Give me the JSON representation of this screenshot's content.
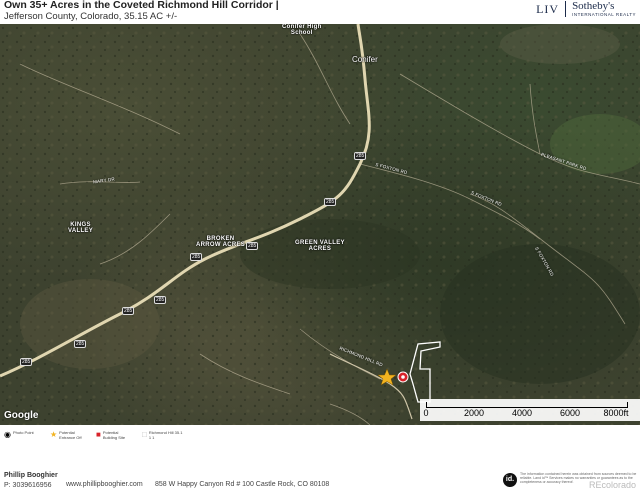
{
  "header": {
    "title": "Own 35+ Acres in the Coveted Richmond Hill Corridor |",
    "subtitle": "Jefferson County, Colorado, 35.15 AC +/-",
    "brand_liv": "LIV",
    "brand_name": "Sotheby's",
    "brand_tagline": "INTERNATIONAL REALTY"
  },
  "map": {
    "places": {
      "conifer_hs": "Conifer High School",
      "conifer": "Conifer",
      "kings_valley": "KINGS VALLEY",
      "broken_arrow": "BROKEN ARROW ACRES",
      "green_valley": "GREEN VALLEY ACRES"
    },
    "roads": {
      "mary_dr": "MARY DR",
      "s_foxton_1": "S FOXTON RD",
      "s_foxton_2": "S FOXTON RD",
      "s_foxton_3": "S FOXTON RD",
      "pleasant_park": "PLEASANT PARK RD",
      "richmond_hill": "RICHMOND HILL RD"
    },
    "route_shield": "285",
    "watermark": "Google",
    "scale": {
      "labels": [
        "0",
        "2000",
        "4000",
        "6000",
        "8000ft"
      ]
    }
  },
  "legend": {
    "photo_point": "Photo Point",
    "entrance": "Potential Entrance Off",
    "building_site": "Potential Building Site",
    "parcel": "Richmond Hill 35.1 1 1"
  },
  "footer": {
    "name": "Phillip Booghier",
    "phone": "P: 3039616956",
    "website": "www.phillipbooghier.com",
    "address": "858 W Happy Canyon Rd # 100 Castle Rock, CO 80108",
    "idx_logo": "id.",
    "disclaimer": "The information contained herein was obtained from sources deemed to be reliable. Land id™ Services makes no warranties or guarantees as to the completeness or accuracy thereof.",
    "watermark": "REcolorado"
  },
  "colors": {
    "parcel_outline": "#ffffff",
    "highway": "#e0d6b0",
    "star": "#f2b320",
    "building_site": "#d8232a"
  }
}
